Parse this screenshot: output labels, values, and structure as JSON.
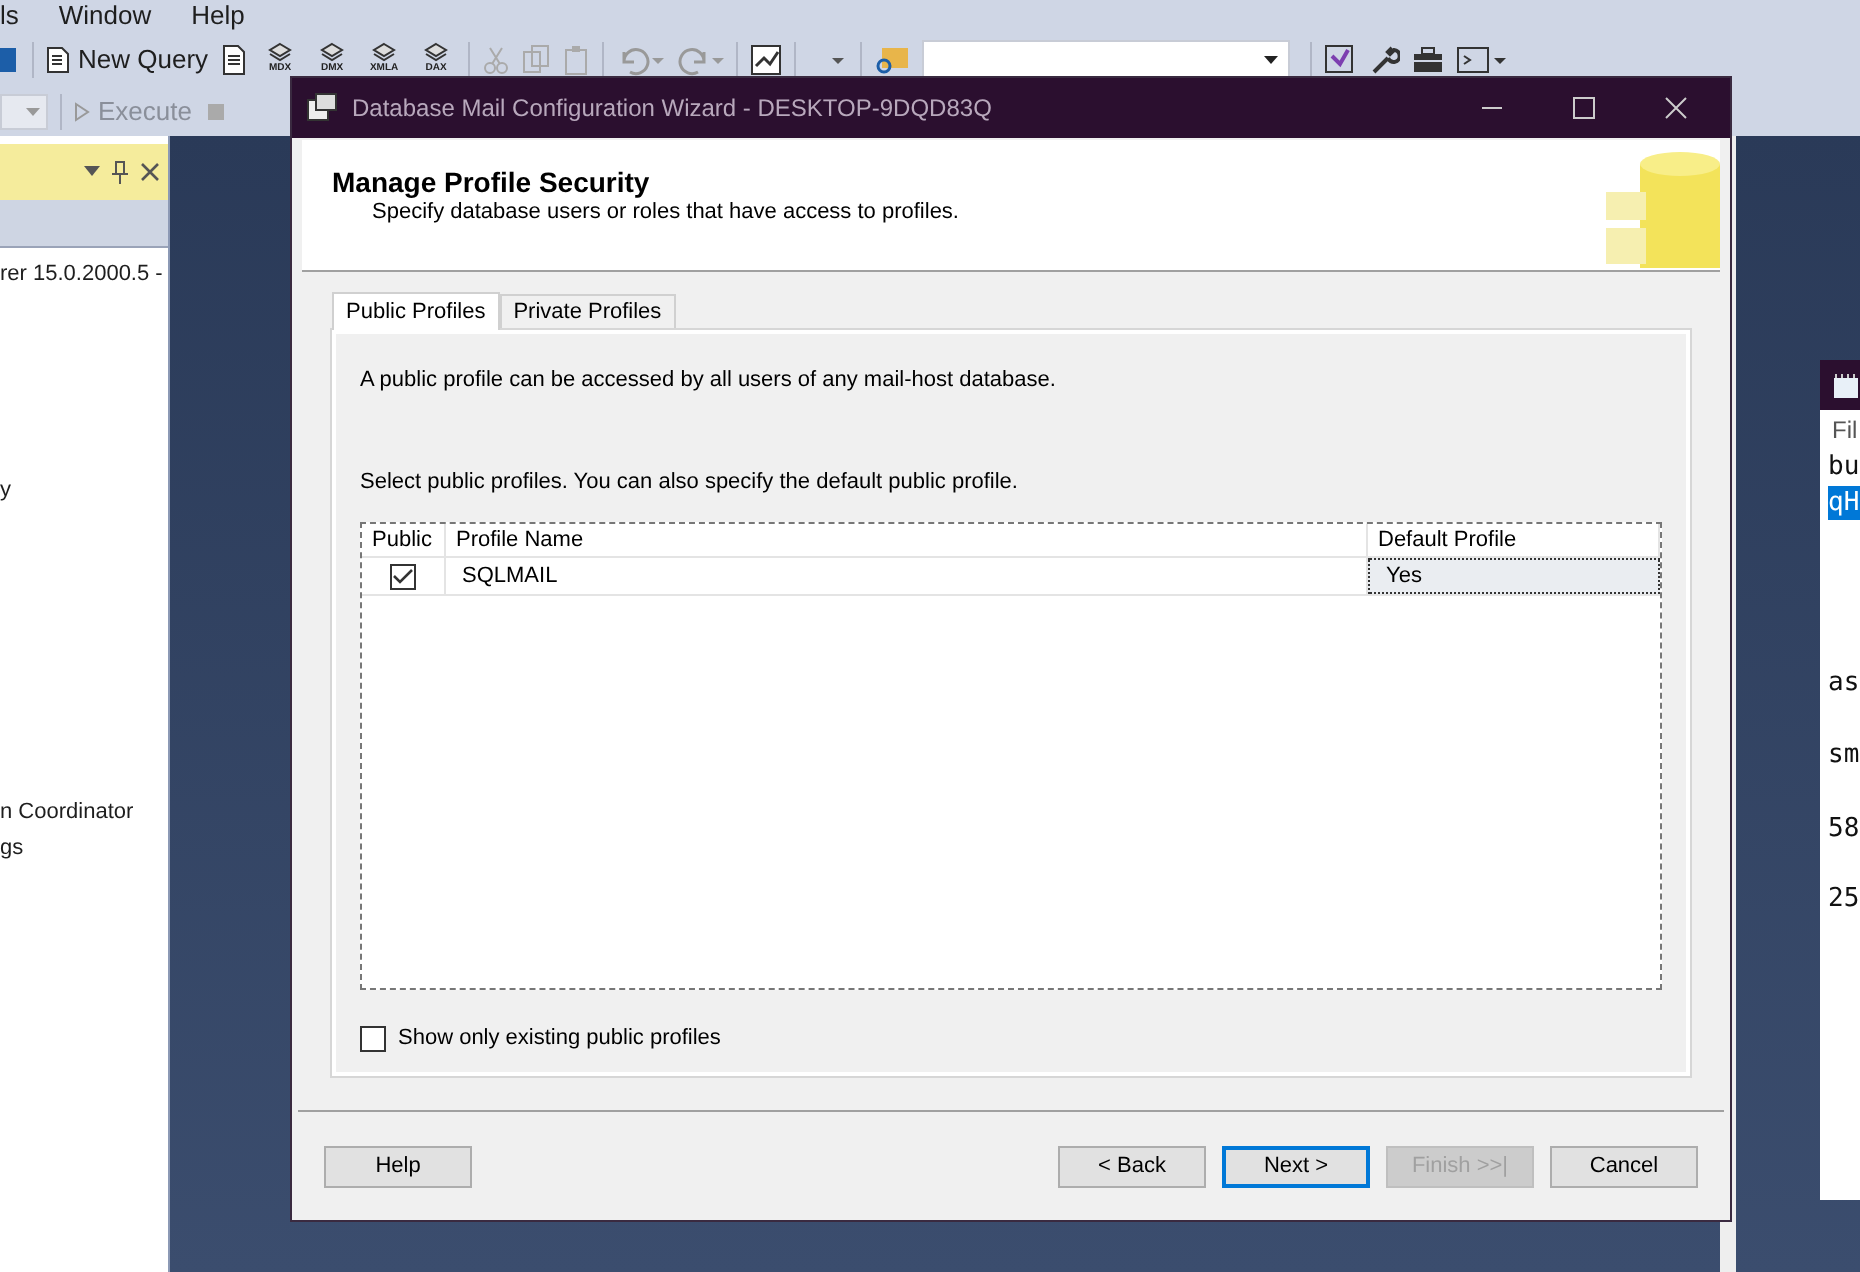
{
  "ide": {
    "menu": [
      "ls",
      "Window",
      "Help"
    ],
    "toolbar": {
      "new_query": "New Query",
      "query_types": [
        "MDX",
        "DMX",
        "XMLA",
        "DAX"
      ]
    },
    "execute": "Execute",
    "object_explorer": {
      "lines": [
        "rer 15.0.2000.5 -",
        "y",
        "n Coordinator",
        "gs"
      ]
    },
    "notepad": {
      "menu": "Fil",
      "lines": [
        {
          "text": "bu",
          "selected": false
        },
        {
          "text": "qH",
          "selected": true
        },
        {
          "text": "as",
          "selected": false
        },
        {
          "text": "sm",
          "selected": false
        },
        {
          "text": "58",
          "selected": false
        },
        {
          "text": "25",
          "selected": false
        }
      ]
    }
  },
  "dialog": {
    "title": "Database Mail Configuration Wizard - DESKTOP-9DQD83Q",
    "heading": "Manage Profile Security",
    "subheading": "Specify database users or roles that have access to profiles.",
    "tabs": [
      {
        "label": "Public Profiles",
        "selected": true
      },
      {
        "label": "Private Profiles",
        "selected": false
      }
    ],
    "description": "A public profile can be accessed by all users of any mail-host database.",
    "instruction": "Select public profiles. You can also specify the default public profile.",
    "table": {
      "columns": [
        "Public",
        "Profile Name",
        "Default Profile"
      ],
      "rows": [
        {
          "public": true,
          "profile_name": "SQLMAIL",
          "default_profile": "Yes"
        }
      ]
    },
    "show_existing": {
      "label": "Show only existing public profiles",
      "checked": false
    },
    "buttons": [
      {
        "label": "Help",
        "disabled": false,
        "default": false
      },
      {
        "label": "< Back",
        "disabled": false,
        "default": false
      },
      {
        "label": "Next >",
        "disabled": false,
        "default": true
      },
      {
        "label": "Finish >>|",
        "disabled": true,
        "default": false
      },
      {
        "label": "Cancel",
        "disabled": false,
        "default": false
      }
    ]
  }
}
